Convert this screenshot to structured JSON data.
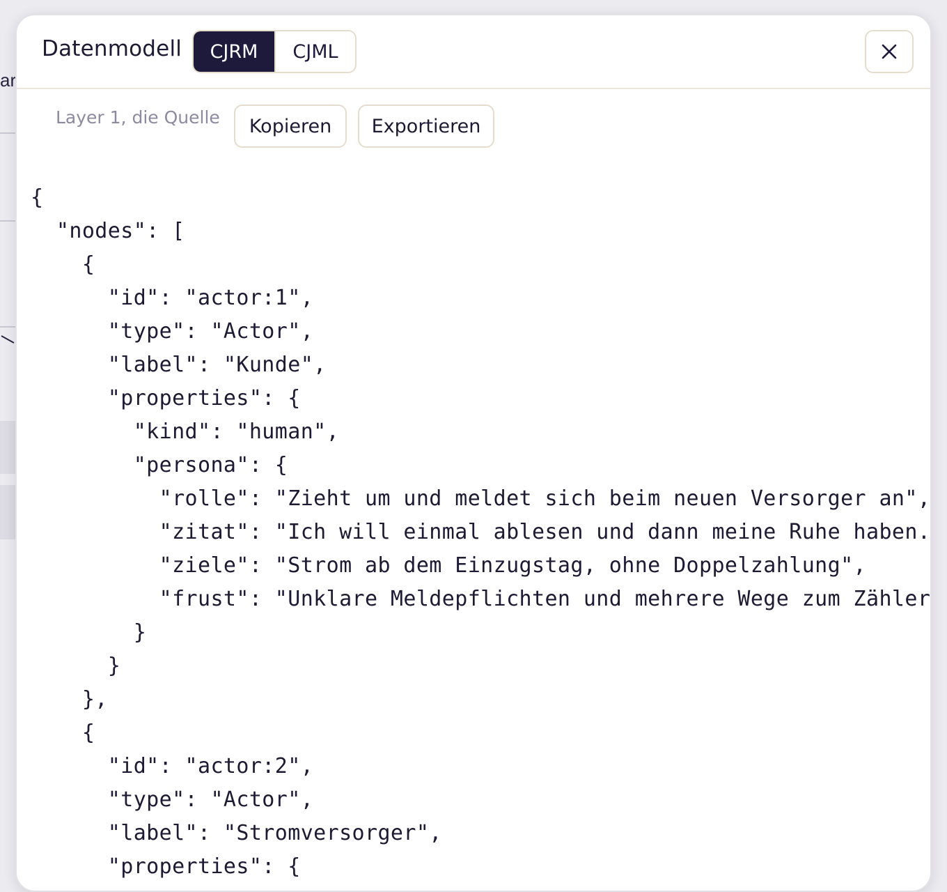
{
  "background": {
    "fragment_text": "ar"
  },
  "dialog": {
    "title": "Datenmodell",
    "tabs": [
      {
        "label": "CJRM",
        "active": true
      },
      {
        "label": "CJML",
        "active": false
      }
    ],
    "close_icon": "close-icon"
  },
  "toolbar": {
    "layer_label": "Layer 1, die Quelle",
    "copy_label": "Kopieren",
    "export_label": "Exportieren"
  },
  "code": {
    "lines": [
      "{",
      "  \"nodes\": [",
      "    {",
      "      \"id\": \"actor:1\",",
      "      \"type\": \"Actor\",",
      "      \"label\": \"Kunde\",",
      "      \"properties\": {",
      "        \"kind\": \"human\",",
      "        \"persona\": {",
      "          \"rolle\": \"Zieht um und meldet sich beim neuen Versorger an\",",
      "          \"zitat\": \"Ich will einmal ablesen und dann meine Ruhe haben.\",",
      "          \"ziele\": \"Strom ab dem Einzugstag, ohne Doppelzahlung\",",
      "          \"frust\": \"Unklare Meldepflichten und mehrere Wege zum Zählerst",
      "        }",
      "      }",
      "    },",
      "    {",
      "      \"id\": \"actor:2\",",
      "      \"type\": \"Actor\",",
      "      \"label\": \"Stromversorger\",",
      "      \"properties\": {"
    ]
  },
  "colors": {
    "accent_dark": "#1e1a3c",
    "border_beige": "#e6dccd",
    "muted_text": "#8d8aa0"
  }
}
